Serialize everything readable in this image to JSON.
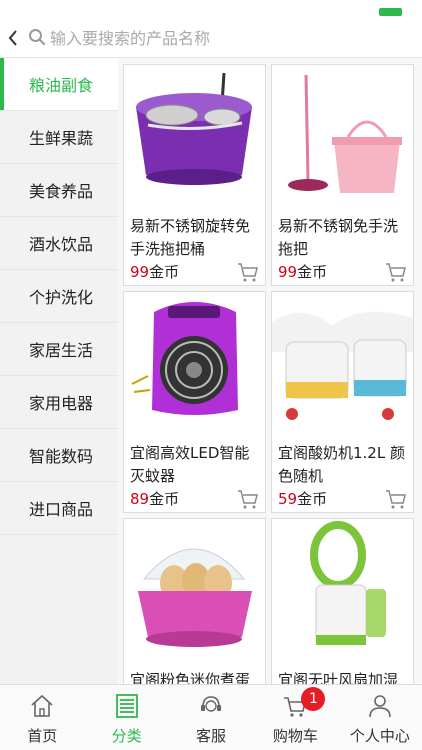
{
  "header": {
    "back_icon": "chevron-left-icon",
    "search_icon": "search-icon",
    "search_placeholder": "输入要搜索的产品名称",
    "search_value": ""
  },
  "sidebar": {
    "items": [
      {
        "label": "粮油副食",
        "active": true
      },
      {
        "label": "生鲜果蔬",
        "active": false
      },
      {
        "label": "美食养品",
        "active": false
      },
      {
        "label": "酒水饮品",
        "active": false
      },
      {
        "label": "个护洗化",
        "active": false
      },
      {
        "label": "家居生活",
        "active": false
      },
      {
        "label": "家用电器",
        "active": false
      },
      {
        "label": "智能数码",
        "active": false
      },
      {
        "label": "进口商品",
        "active": false
      }
    ]
  },
  "products": [
    {
      "name": "易新不锈钢旋转免手洗拖把桶",
      "price": "99",
      "currency": "金币",
      "image": "spin-mop-bucket-image"
    },
    {
      "name": "易新不锈钢免手洗拖把",
      "price": "99",
      "currency": "金币",
      "image": "mop-and-bucket-image"
    },
    {
      "name": "宜阁高效LED智能灭蚊器",
      "price": "89",
      "currency": "金币",
      "image": "mosquito-killer-image"
    },
    {
      "name": "宜阁酸奶机1.2L 颜色随机",
      "price": "59",
      "currency": "金币",
      "image": "yogurt-maker-image"
    },
    {
      "name": "宜阁粉色迷你煮蛋",
      "price": "",
      "currency": "",
      "image": "egg-boiler-image"
    },
    {
      "name": "宜阁无叶风扇加湿",
      "price": "",
      "currency": "",
      "image": "bladeless-humidifier-image"
    }
  ],
  "tabbar": {
    "items": [
      {
        "label": "首页",
        "icon": "home-icon",
        "active": false
      },
      {
        "label": "分类",
        "icon": "category-list-icon",
        "active": true
      },
      {
        "label": "客服",
        "icon": "customer-service-icon",
        "active": false
      },
      {
        "label": "购物车",
        "icon": "shopping-cart-icon",
        "active": false,
        "badge": "1"
      },
      {
        "label": "个人中心",
        "icon": "user-icon",
        "active": false
      }
    ]
  },
  "colors": {
    "accent": "#2db84d",
    "price": "#d0021b",
    "badge": "#e41e26"
  }
}
